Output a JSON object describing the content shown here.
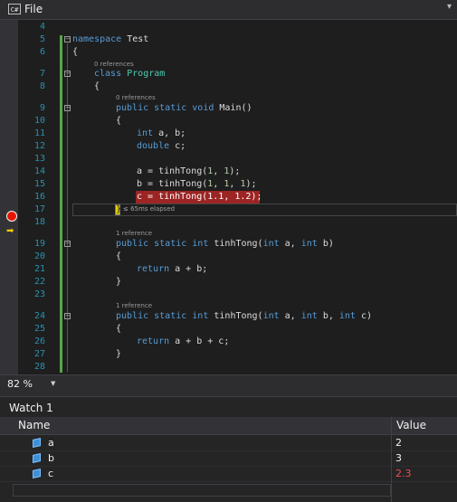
{
  "file_bar": {
    "lang_badge": "C#",
    "title": "File",
    "dropdown_icon": "chevron-down-icon"
  },
  "editor": {
    "line_numbers": [
      "4",
      "5",
      "6",
      "7",
      "8",
      "9",
      "10",
      "11",
      "12",
      "13",
      "14",
      "15",
      "16",
      "17",
      "18",
      "19",
      "20",
      "21",
      "22",
      "23",
      "24",
      "25",
      "26",
      "27",
      "28"
    ],
    "lens": {
      "program": "0 references",
      "main": "0 references",
      "tinhtong2": "1 reference",
      "tinhtong3": "1 reference"
    },
    "code": {
      "l5_kw": "namespace",
      "l5_name": " Test",
      "l6": "{",
      "l7_kw": "class",
      "l7_name": "Program",
      "l8": "{",
      "l9_kw": "public static void",
      "l9_rest": " Main()",
      "l10": "{",
      "l11_kw": "int",
      "l11_rest": " a, b;",
      "l12_kw": "double",
      "l12_rest": " c;",
      "l14": "a = tinhTong(",
      "l14_n1": "1",
      "l14_sep": ", ",
      "l14_n2": "1",
      "l14_end": ");",
      "l15": "b = tinhTong(",
      "l15_n1": "1",
      "l15_n2": "1",
      "l15_n3": "1",
      "l15_end": ");",
      "l16": "c = tinhTong(1.1, 1.2);",
      "l17_caret": "}",
      "l17_elapsed": "≤ 65ms elapsed",
      "l19_kw": "public static int",
      "l19_fn": " tinhTong(",
      "l19_int1": "int",
      "l19_a": " a, ",
      "l19_int2": "int",
      "l19_b": " b)",
      "l20": "{",
      "l21_kw": "return",
      "l21_rest": " a + b;",
      "l22": "}",
      "l24_kw": "public static int",
      "l24_fn": " tinhTong(",
      "l24_int1": "int",
      "l24_a": " a, ",
      "l24_int2": "int",
      "l24_b": " b, ",
      "l24_int3": "int",
      "l24_c": " c)",
      "l25": "{",
      "l26_kw": "return",
      "l26_rest": " a + b + c;",
      "l27": "}"
    }
  },
  "zoom": {
    "level": "82 %"
  },
  "watch": {
    "title": "Watch 1",
    "columns": {
      "name": "Name",
      "value": "Value"
    },
    "rows": [
      {
        "name": "a",
        "value": "2"
      },
      {
        "name": "b",
        "value": "3"
      },
      {
        "name": "c",
        "value": "2.3"
      }
    ]
  },
  "colors": {
    "breakpoint": "#e51400",
    "changed_value": "#f14c4c",
    "keyword": "#569cd6",
    "type": "#4ec9b0",
    "number": "#b5cea8"
  }
}
